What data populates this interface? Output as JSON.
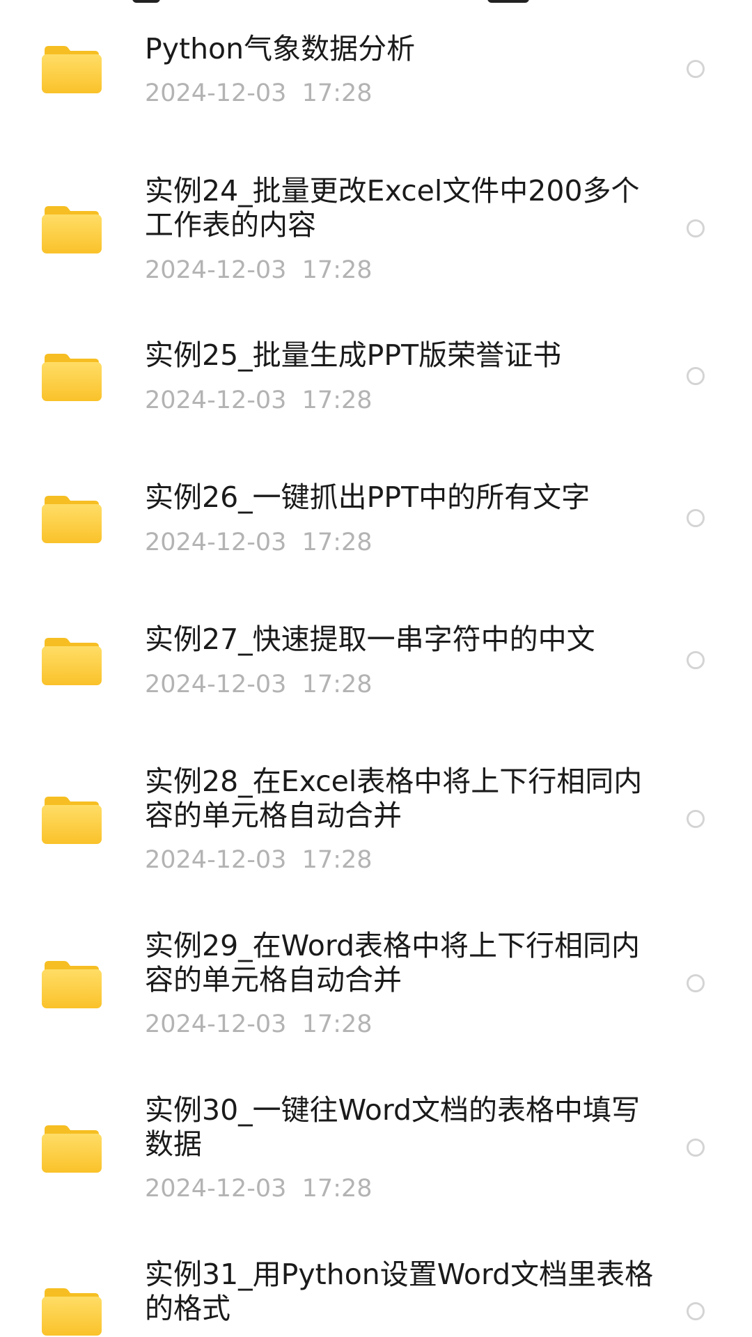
{
  "file_list": {
    "items": [
      {
        "name": "Python气象数据分析",
        "date": "2024-12-03  17:28",
        "icon": "folder-icon"
      },
      {
        "name": "实例24_批量更改Excel文件中200多个工作表的内容",
        "date": "2024-12-03  17:28",
        "icon": "folder-icon"
      },
      {
        "name": "实例25_批量生成PPT版荣誉证书",
        "date": "2024-12-03  17:28",
        "icon": "folder-icon"
      },
      {
        "name": "实例26_一键抓出PPT中的所有文字",
        "date": "2024-12-03  17:28",
        "icon": "folder-icon"
      },
      {
        "name": "实例27_快速提取一串字符中的中文",
        "date": "2024-12-03  17:28",
        "icon": "folder-icon"
      },
      {
        "name": "实例28_在Excel表格中将上下行相同内容的单元格自动合并",
        "date": "2024-12-03  17:28",
        "icon": "folder-icon"
      },
      {
        "name": "实例29_在Word表格中将上下行相同内容的单元格自动合并",
        "date": "2024-12-03  17:28",
        "icon": "folder-icon"
      },
      {
        "name": "实例30_一键往Word文档的表格中填写数据",
        "date": "2024-12-03  17:28",
        "icon": "folder-icon"
      },
      {
        "name": "实例31_用Python设置Word文档里表格的格式",
        "date": "",
        "icon": "folder-icon"
      }
    ]
  },
  "colors": {
    "folder_top": "#FFD85A",
    "folder_bottom": "#FBC62B",
    "folder_tab": "#F6BE22",
    "title_text": "#1a1a1a",
    "date_text": "#b3b3b3",
    "radio_border": "#d4d4d4"
  }
}
